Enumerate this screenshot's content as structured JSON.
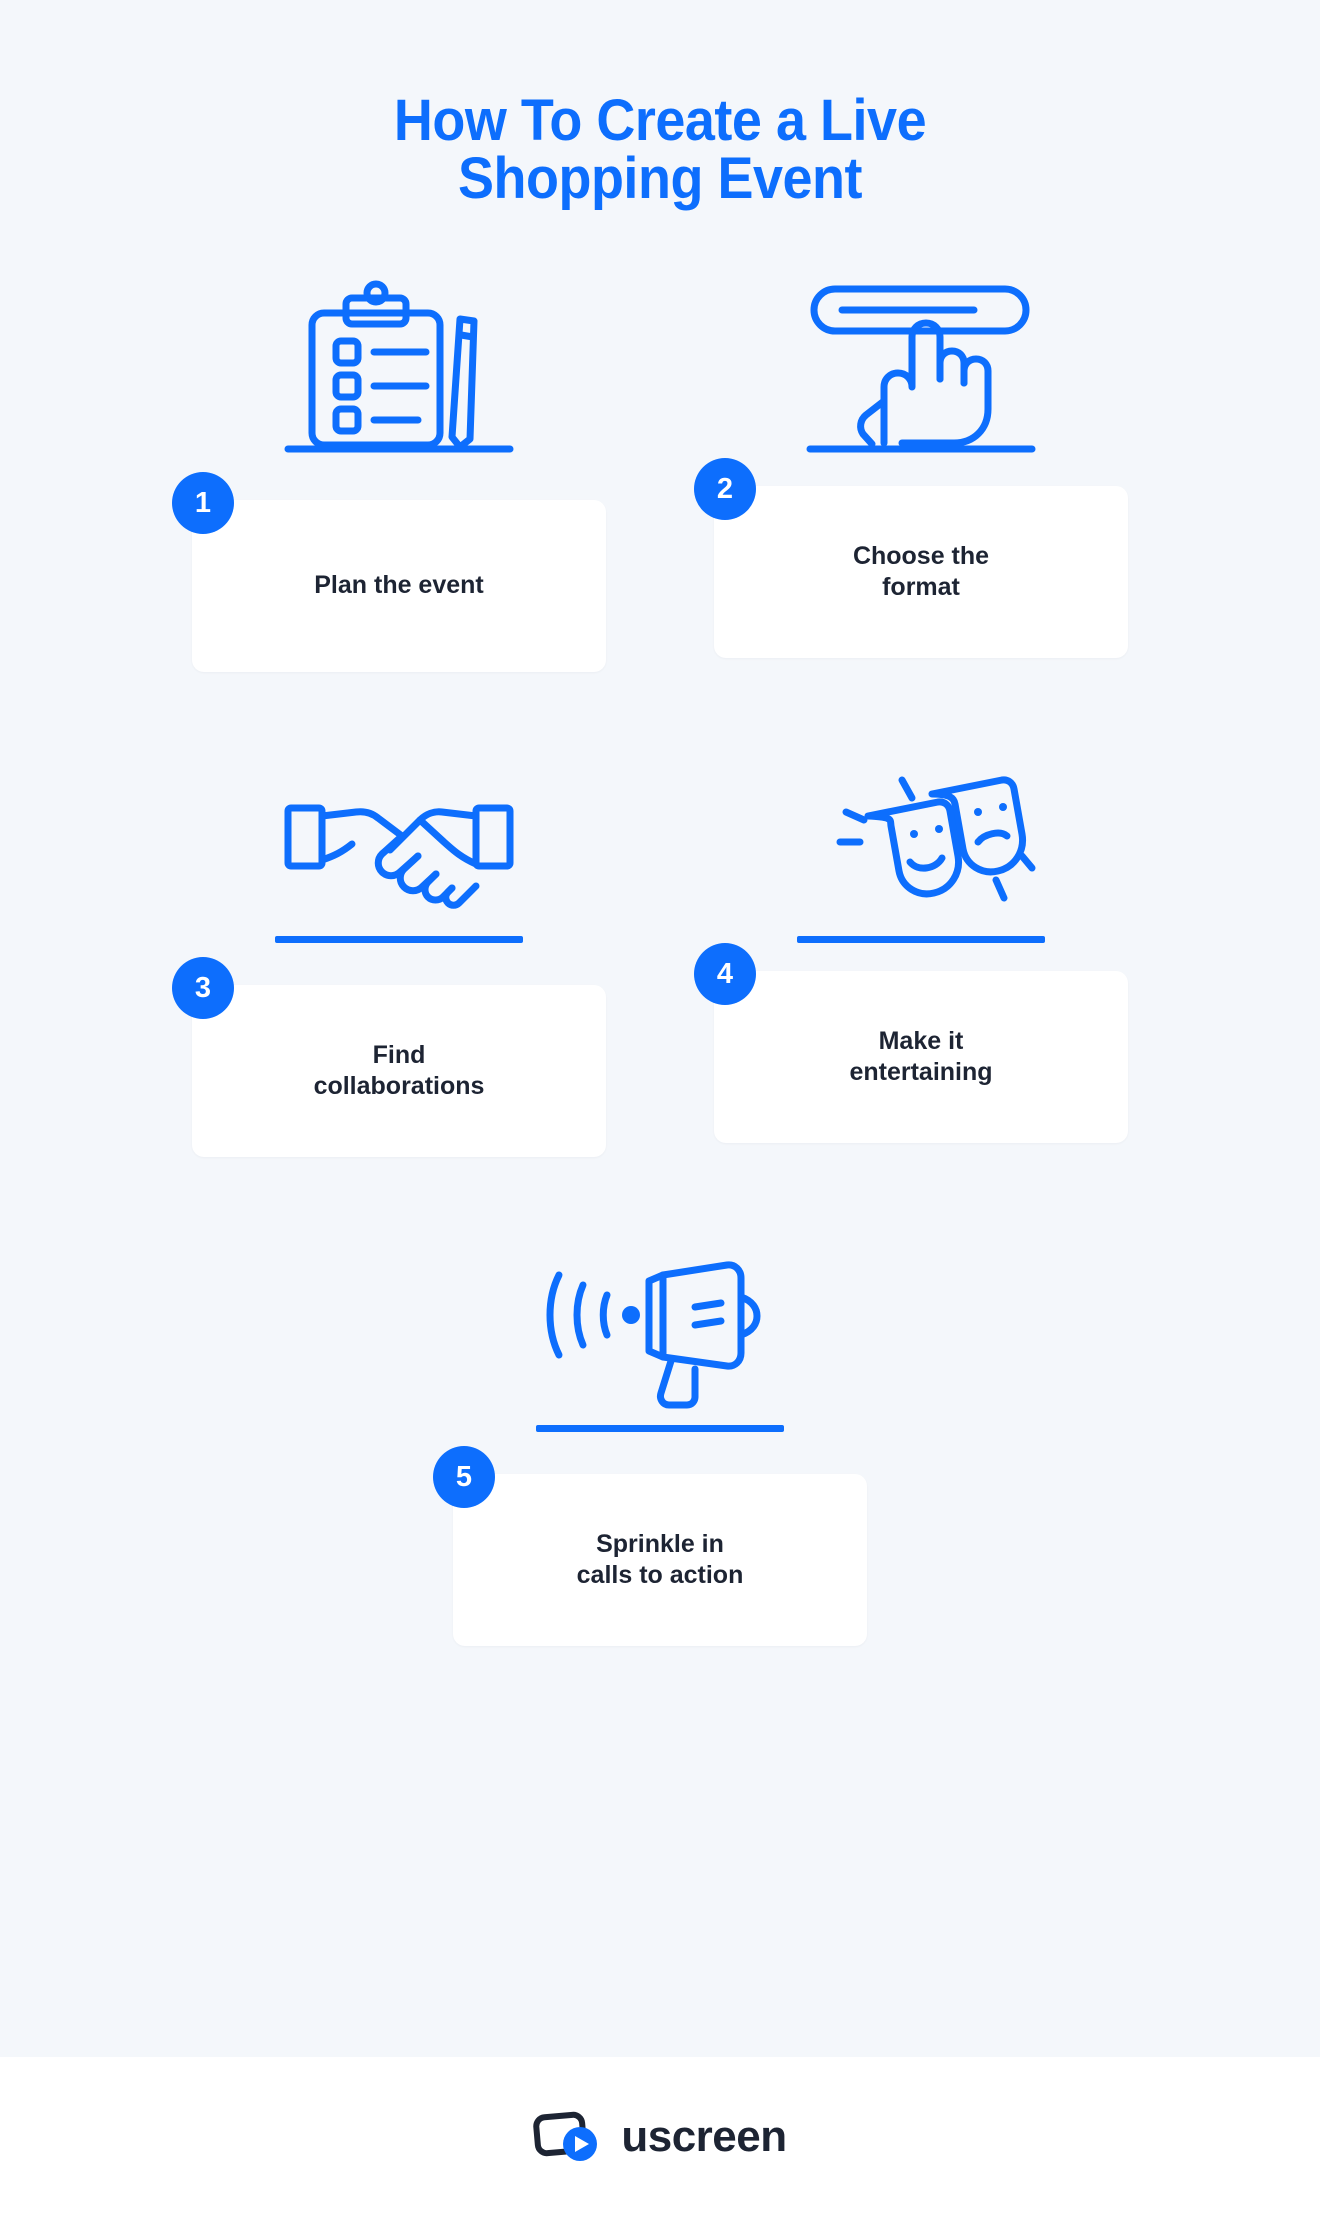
{
  "title": {
    "line1": "How To Create a Live",
    "line2": "Shopping Event"
  },
  "colors": {
    "background": "#f4f7fb",
    "accent_blue": "#0d6efd",
    "card_background": "#ffffff",
    "text_dark": "#1d2433",
    "footer_background": "#ffffff"
  },
  "steps": [
    {
      "number": "1",
      "label": "Plan the event",
      "icon": "clipboard-checklist-icon"
    },
    {
      "number": "2",
      "label": "Choose the\nformat",
      "icon": "hand-pointer-select-icon"
    },
    {
      "number": "3",
      "label": "Find\ncollaborations",
      "icon": "handshake-icon"
    },
    {
      "number": "4",
      "label": "Make it\nentertaining",
      "icon": "theater-masks-icon"
    },
    {
      "number": "5",
      "label": "Sprinkle in\ncalls to action",
      "icon": "megaphone-icon"
    }
  ],
  "footer": {
    "brand": "uscreen",
    "logo_icon": "uscreen-play-logo-icon"
  }
}
